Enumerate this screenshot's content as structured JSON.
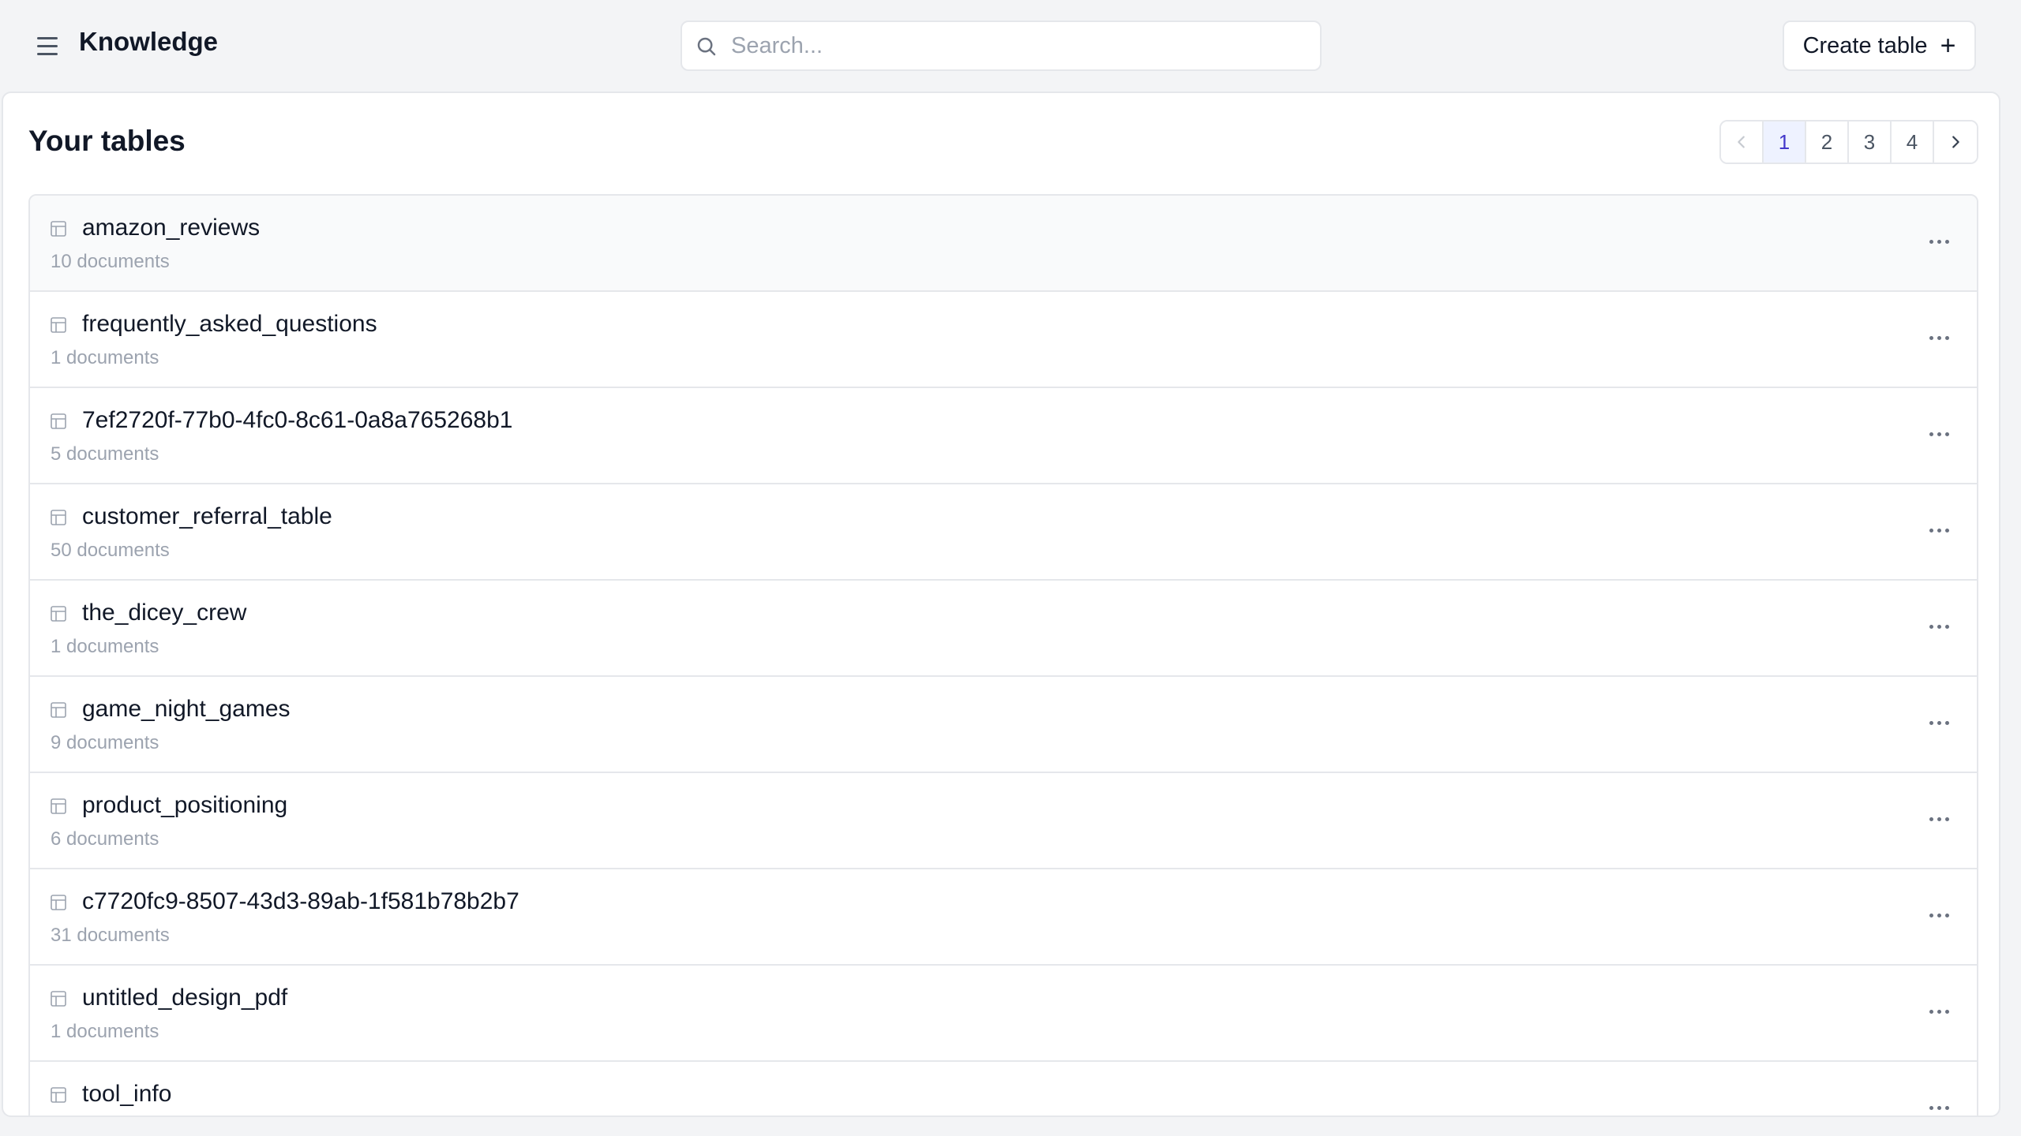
{
  "header": {
    "title": "Knowledge",
    "search_placeholder": "Search...",
    "create_label": "Create table",
    "menu_icon": "menu-icon",
    "search_icon": "search-icon",
    "plus_icon": "plus-icon"
  },
  "main": {
    "title": "Your tables",
    "pagination": {
      "pages": [
        "1",
        "2",
        "3",
        "4"
      ],
      "current": "1",
      "prev_icon": "chevron-left-icon",
      "next_icon": "chevron-right-icon"
    },
    "tables": [
      {
        "name": "amazon_reviews",
        "count": "10 documents"
      },
      {
        "name": "frequently_asked_questions",
        "count": "1 documents"
      },
      {
        "name": "7ef2720f-77b0-4fc0-8c61-0a8a765268b1",
        "count": "5 documents"
      },
      {
        "name": "customer_referral_table",
        "count": "50 documents"
      },
      {
        "name": "the_dicey_crew",
        "count": "1 documents"
      },
      {
        "name": "game_night_games",
        "count": "9 documents"
      },
      {
        "name": "product_positioning",
        "count": "6 documents"
      },
      {
        "name": "c7720fc9-8507-43d3-89ab-1f581b78b2b7",
        "count": "31 documents"
      },
      {
        "name": "untitled_design_pdf",
        "count": "1 documents"
      },
      {
        "name": "tool_info",
        "count": ""
      }
    ],
    "row_icon": "table-icon",
    "row_action_icon": "more-horizontal-icon"
  },
  "colors": {
    "background": "#f3f4f6",
    "panel": "#ffffff",
    "border": "#e5e7eb",
    "muted_text": "#9ca3af",
    "active_page_bg": "#eef2ff",
    "active_page_text": "#4338ca"
  }
}
